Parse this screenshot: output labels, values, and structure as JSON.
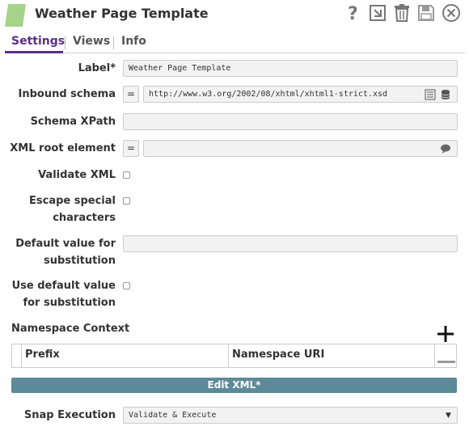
{
  "header": {
    "title": "Weather Page Template",
    "icons": [
      "help-icon",
      "export-icon",
      "delete-icon",
      "save-icon",
      "close-icon"
    ]
  },
  "tabs": [
    {
      "label": "Settings",
      "active": true
    },
    {
      "label": "Views",
      "active": false
    },
    {
      "label": "Info",
      "active": false
    }
  ],
  "form": {
    "label": {
      "label": "Label*",
      "value": "Weather Page Template"
    },
    "inbound_schema": {
      "label": "Inbound schema",
      "expr_toggle": "=",
      "value": "http://www.w3.org/2002/08/xhtml/xhtml1-strict.xsd"
    },
    "schema_xpath": {
      "label": "Schema XPath",
      "value": ""
    },
    "xml_root_element": {
      "label": "XML root element",
      "expr_toggle": "=",
      "value": ""
    },
    "validate_xml": {
      "label": "Validate XML",
      "checked": false
    },
    "escape_special": {
      "label_line1": "Escape special",
      "label_line2": "characters",
      "checked": false
    },
    "default_value": {
      "label_line1": "Default value for",
      "label_line2": "substitution",
      "value": ""
    },
    "use_default": {
      "label_line1": "Use default value",
      "label_line2": "for substitution",
      "checked": false
    }
  },
  "namespace": {
    "section_label": "Namespace Context",
    "columns": [
      "Prefix",
      "Namespace URI"
    ]
  },
  "edit_xml_label": "Edit XML*",
  "snap_execution": {
    "label": "Snap Execution",
    "selected": "Validate & Execute"
  },
  "colors": {
    "accent": "#5a2e8a",
    "snap_icon": "#a5d38a",
    "edit_bar": "#5c8a98"
  }
}
